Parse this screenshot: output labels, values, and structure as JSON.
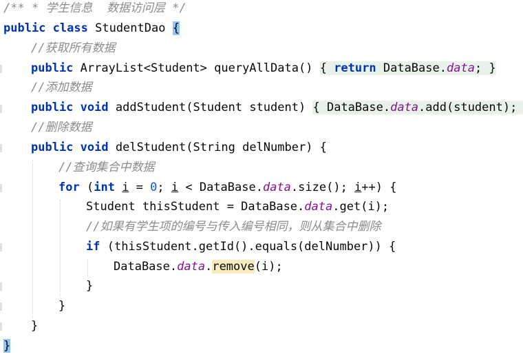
{
  "code": {
    "l1_comment": "/** * 学生信息  数据访问层 */",
    "l2_kw1": "public",
    "l2_kw2": "class",
    "l2_name": "StudentDao",
    "l2_brace": "{",
    "l3_comment": "//获取所有数据",
    "l4_kw": "public",
    "l4_sig": "ArrayList<Student> queryAllData()",
    "l4_open": "{",
    "l4_ret": "return",
    "l4_db": "DataBase.",
    "l4_field": "data",
    "l4_semi": ";",
    "l4_close": "}",
    "l5_comment": "//添加数据",
    "l6_kw1": "public",
    "l6_kw2": "void",
    "l6_sig": "addStudent(Student student)",
    "l6_open": "{",
    "l6_db": "DataBase.",
    "l6_field": "data",
    "l6_call": ".add(student);",
    "l6_close": "}",
    "l7_comment": "//删除数据",
    "l8_kw1": "public",
    "l8_kw2": "void",
    "l8_sig": "delStudent(String delNumber) {",
    "l9_comment": "//查询集合中数据",
    "l10_for": "for",
    "l10_p": "(",
    "l10_int": "int",
    "l10_i1": "i",
    "l10_eq": " = ",
    "l10_zero": "0",
    "l10_semi1": "; ",
    "l10_i2": "i",
    "l10_lt": " < DataBase.",
    "l10_field": "data",
    "l10_size": ".size(); ",
    "l10_i3": "i",
    "l10_end": "++) {",
    "l11_a": "Student thisStudent = DataBase.",
    "l11_field": "data",
    "l11_b": ".get(i);",
    "l12_comment": "//如果有学生项的编号与传入编号相同，则从集合中删除",
    "l13_if": "if",
    "l13_rest": " (thisStudent.getId().equals(delNumber)) {",
    "l14_db": "DataBase.",
    "l14_field": "data",
    "l14_dot": ".",
    "l14_remove": "remove",
    "l14_end": "(i);",
    "l15": "}",
    "l16": "}",
    "l17": "}",
    "l18": "}"
  },
  "colors": {
    "keyword": "#0033b3",
    "comment": "#8c8c8c",
    "field": "#871094",
    "number": "#1750eb",
    "brace_match": "#93c4f4",
    "warning": "#f6ebbc"
  }
}
